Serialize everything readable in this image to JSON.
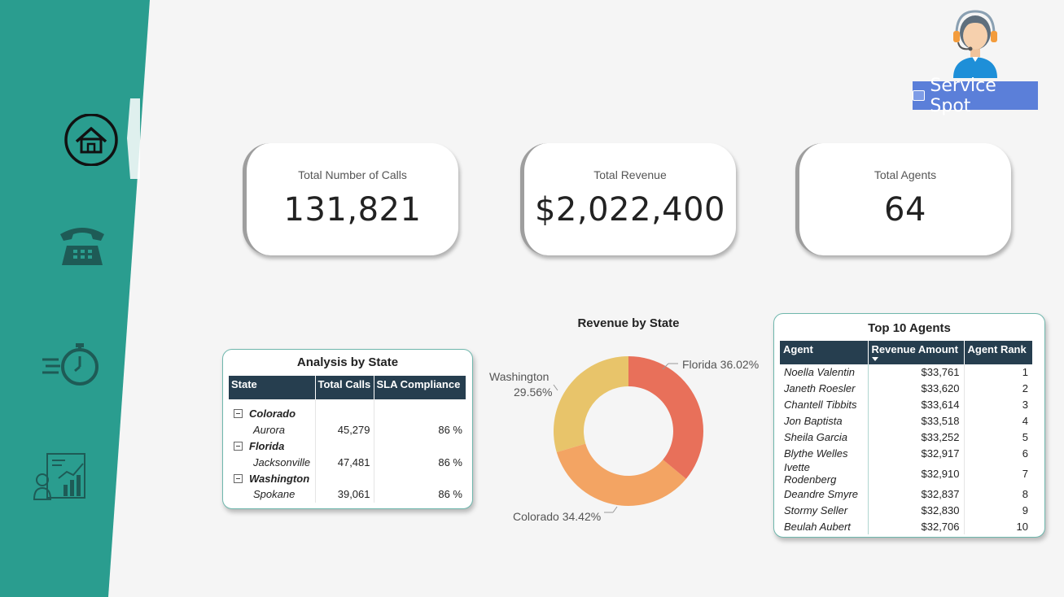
{
  "brand": {
    "name": "Service Spot",
    "banner_color": "#5b7fd9"
  },
  "colors": {
    "sidebar": "#2a9d8f",
    "header_bg": "#263e4f",
    "panel_border": "#6fb7ad"
  },
  "nav": [
    {
      "name": "home",
      "icon": "home-icon",
      "active": true
    },
    {
      "name": "calls",
      "icon": "telephone-icon",
      "active": false
    },
    {
      "name": "response-time",
      "icon": "stopwatch-icon",
      "active": false
    },
    {
      "name": "agents",
      "icon": "agent-report-icon",
      "active": false
    }
  ],
  "kpis": [
    {
      "label": "Total Number of Calls",
      "value": "131,821"
    },
    {
      "label": "Total Revenue",
      "value": "$2,022,400"
    },
    {
      "label": "Total Agents",
      "value": "64"
    }
  ],
  "analysis": {
    "title": "Analysis by State",
    "columns": [
      "State",
      "Total Calls",
      "SLA Compliance"
    ],
    "groups": [
      {
        "state": "Colorado",
        "city": "Aurora",
        "calls": "45,279",
        "sla": "86 %"
      },
      {
        "state": "Florida",
        "city": "Jacksonville",
        "calls": "47,481",
        "sla": "86 %"
      },
      {
        "state": "Washington",
        "city": "Spokane",
        "calls": "39,061",
        "sla": "86 %"
      }
    ]
  },
  "revenue_chart": {
    "title": "Revenue by State",
    "labels": {
      "florida": "Florida 36.02%",
      "washington_name": "Washington",
      "washington_pct": "29.56%",
      "colorado": "Colorado 34.42%"
    }
  },
  "chart_data": {
    "type": "pie",
    "title": "Revenue by State",
    "donut": true,
    "categories": [
      "Florida",
      "Colorado",
      "Washington"
    ],
    "values": [
      36.02,
      34.42,
      29.56
    ],
    "colors": [
      "#e8705a",
      "#f3a463",
      "#e8c46a"
    ]
  },
  "agents": {
    "title": "Top 10 Agents",
    "columns": [
      "Agent",
      "Revenue Amount",
      "Agent Rank"
    ],
    "rows": [
      {
        "agent": "Noella Valentin",
        "revenue": "$33,761",
        "rank": "1"
      },
      {
        "agent": "Janeth Roesler",
        "revenue": "$33,620",
        "rank": "2"
      },
      {
        "agent": "Chantell Tibbits",
        "revenue": "$33,614",
        "rank": "3"
      },
      {
        "agent": "Jon Baptista",
        "revenue": "$33,518",
        "rank": "4"
      },
      {
        "agent": "Sheila Garcia",
        "revenue": "$33,252",
        "rank": "5"
      },
      {
        "agent": "Blythe Welles",
        "revenue": "$32,917",
        "rank": "6"
      },
      {
        "agent": "Ivette Rodenberg",
        "revenue": "$32,910",
        "rank": "7"
      },
      {
        "agent": "Deandre Smyre",
        "revenue": "$32,837",
        "rank": "8"
      },
      {
        "agent": "Stormy Seller",
        "revenue": "$32,830",
        "rank": "9"
      },
      {
        "agent": "Beulah Aubert",
        "revenue": "$32,706",
        "rank": "10"
      }
    ]
  }
}
